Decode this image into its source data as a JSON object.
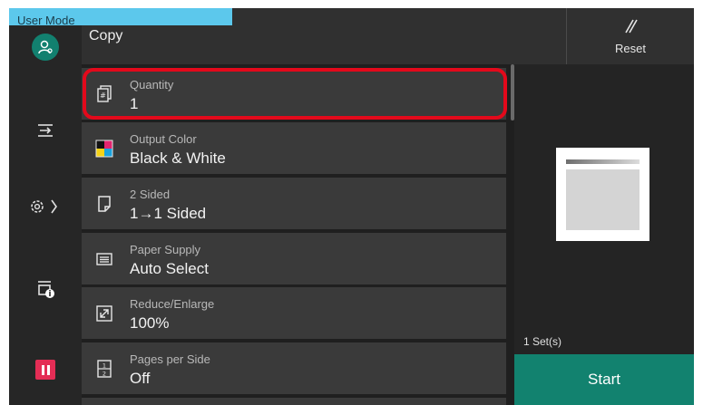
{
  "mode_tab": {
    "label": "User Mode"
  },
  "header": {
    "title": "Copy",
    "reset_label": "Reset"
  },
  "left_rail": {
    "icons": [
      "user-icon",
      "job-flow-icon",
      "settings-icon",
      "printer-info-icon",
      "pause-icon"
    ],
    "accent_color": "#12806f",
    "pause_color": "#e42d55"
  },
  "settings": [
    {
      "label": "Quantity",
      "value": "1",
      "icon": "quantity-icon",
      "highlighted": true
    },
    {
      "label": "Output Color",
      "value": "Black & White",
      "icon": "output-color-icon"
    },
    {
      "label": "2 Sided",
      "value": "1→1 Sided",
      "icon": "two-sided-icon"
    },
    {
      "label": "Paper Supply",
      "value": "Auto Select",
      "icon": "paper-supply-icon"
    },
    {
      "label": "Reduce/Enlarge",
      "value": "100%",
      "icon": "reduce-enlarge-icon"
    },
    {
      "label": "Pages per Side",
      "value": "Off",
      "icon": "pages-per-side-icon"
    }
  ],
  "preview": {
    "sets_text": "1 Set(s)",
    "start_label": "Start",
    "start_color": "#12826f"
  },
  "highlight_color": "#e3091b"
}
